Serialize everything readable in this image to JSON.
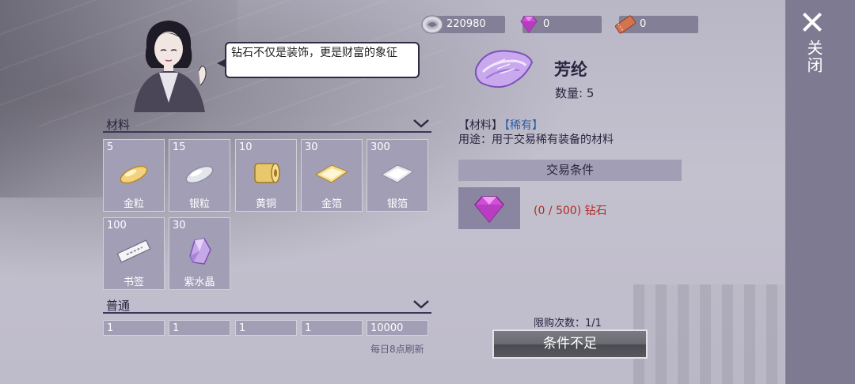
{
  "currency": [
    {
      "icon": "coin-icon",
      "value": "220980"
    },
    {
      "icon": "diamond-icon",
      "value": "0"
    },
    {
      "icon": "ticket-icon",
      "value": "0"
    }
  ],
  "close": {
    "label": "关闭"
  },
  "npc": {
    "speech": "钻石不仅是装饰，更是财富的象征"
  },
  "sections": {
    "materials": {
      "title": "材料",
      "items": [
        {
          "count": "5",
          "name": "金粒",
          "icon": "gold-grain-icon"
        },
        {
          "count": "15",
          "name": "银粒",
          "icon": "silver-grain-icon"
        },
        {
          "count": "10",
          "name": "黄铜",
          "icon": "brass-roll-icon"
        },
        {
          "count": "30",
          "name": "金箔",
          "icon": "gold-foil-icon"
        },
        {
          "count": "300",
          "name": "银箔",
          "icon": "silver-foil-icon"
        },
        {
          "count": "100",
          "name": "书签",
          "icon": "bookmark-icon"
        },
        {
          "count": "30",
          "name": "紫水晶",
          "icon": "amethyst-icon"
        }
      ]
    },
    "normal": {
      "title": "普通",
      "items": [
        {
          "count": "1"
        },
        {
          "count": "1"
        },
        {
          "count": "1"
        },
        {
          "count": "1"
        },
        {
          "count": "10000"
        }
      ]
    }
  },
  "refresh_note": "每日8点刷新",
  "detail": {
    "title": "芳纶",
    "quantity": "数量: 5",
    "tag_category": "【材料】",
    "tag_rarity": "【稀有】",
    "usage": "用途：用于交易稀有装备的材料",
    "condition_header": "交易条件",
    "condition_text": "(0 / 500) 钻石",
    "purchase_limit": "限购次数：1/1",
    "action_label": "条件不足"
  },
  "colors": {
    "rare": "#2c5ea8",
    "insufficient": "#b22a22",
    "tile": "#a29eb6"
  }
}
